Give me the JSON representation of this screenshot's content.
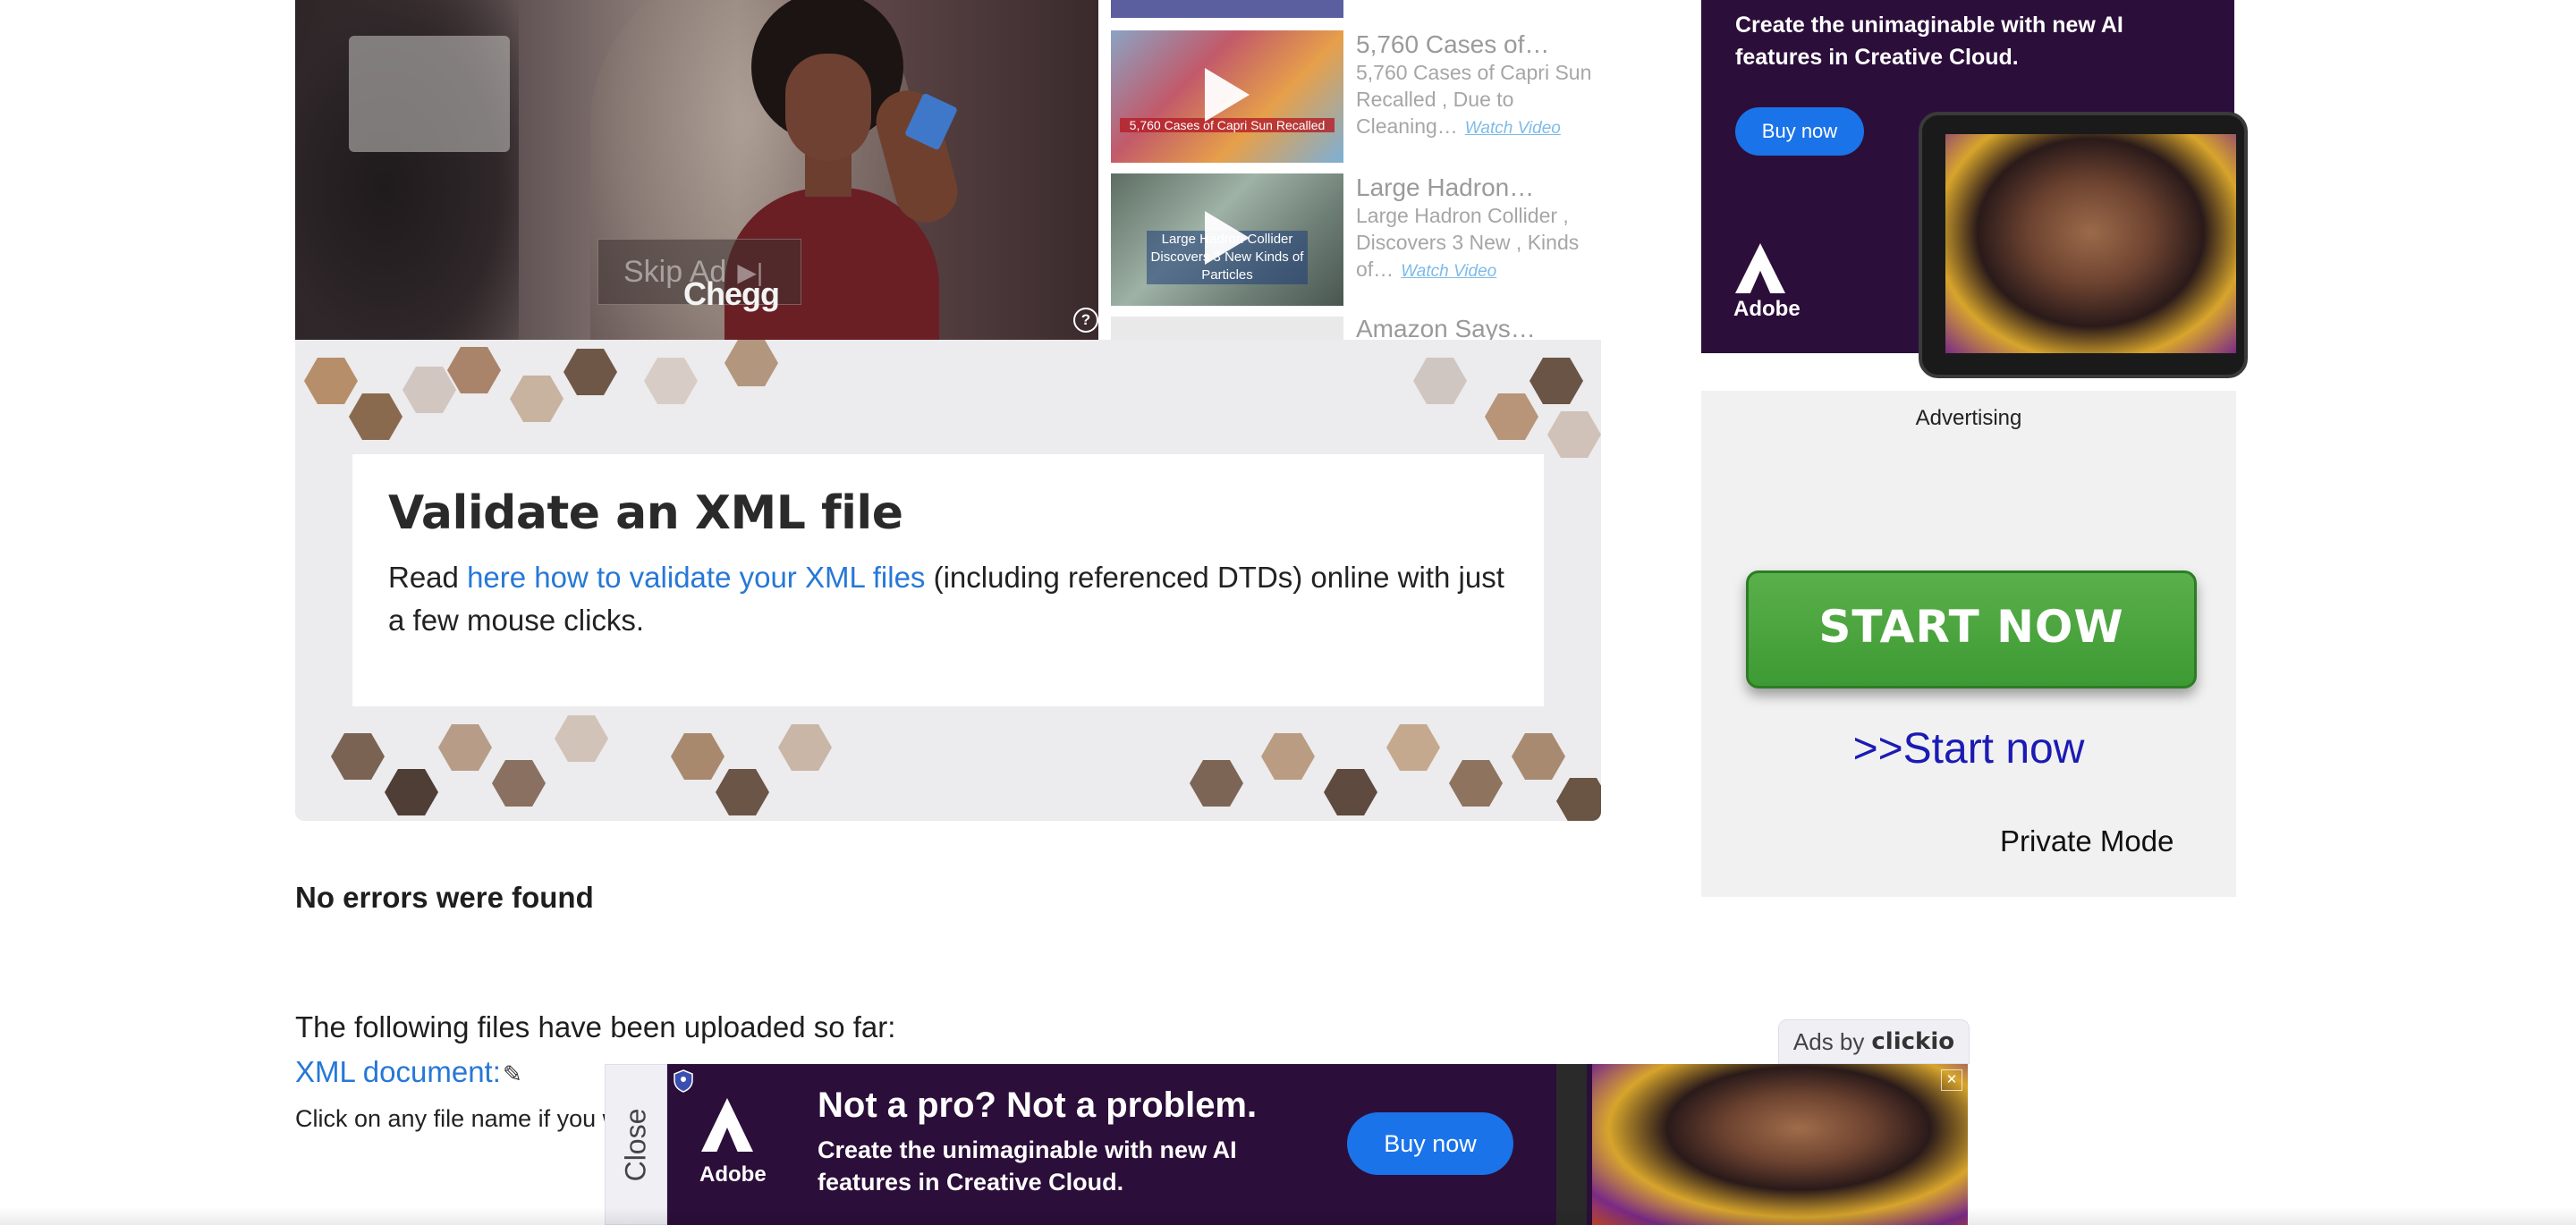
{
  "video": {
    "skip_label": "Skip Ad",
    "skip_icon": "skip-next-icon",
    "brand": "Chegg",
    "help_icon": "?"
  },
  "playlist": [
    {
      "title": "5,760 Cases of…",
      "desc": "5,760 Cases of Capri Sun Recalled , Due to Cleaning…",
      "watch": "Watch Video",
      "thumb_caption": "5,760 Cases of Capri Sun Recalled"
    },
    {
      "title": "Large Hadron…",
      "desc": "Large Hadron Collider , Discovers 3 New , Kinds of…",
      "watch": "Watch Video",
      "thumb_caption": "Large Hadron Collider Discovers 3 New Kinds of Particles"
    },
    {
      "title": "Amazon Says…"
    }
  ],
  "hero": {
    "title": "Validate an XML file",
    "text_before": "Read ",
    "link": "here how to validate your XML files",
    "text_after": " (including referenced DTDs) online with just a few mouse clicks."
  },
  "results": {
    "status": "No errors were found",
    "uploaded_heading": "The following files have been uploaded so far:",
    "file_link": "XML document:",
    "click_hint": "Click on any file name if you w"
  },
  "ad_top": {
    "text": "Create the unimaginable with new AI features in Creative Cloud.",
    "buy": "Buy now",
    "brand": "Adobe"
  },
  "ad_side": {
    "label": "Advertising",
    "button": "START NOW",
    "link": ">>Start now",
    "mode": "Private Mode"
  },
  "sticky_ad": {
    "ads_by": "Ads by",
    "ads_by_brand": "clickio",
    "close": "Close",
    "headline": "Not a pro? Not a problem.",
    "sub": "Create the unimaginable with new AI features in Creative Cloud.",
    "buy": "Buy now",
    "brand": "Adobe"
  },
  "colors": {
    "link": "#2678d6",
    "adobe_bg": "#2c0e3a",
    "adobe_button": "#1a73e8",
    "start_green": "#4aa63c",
    "start_link": "#1b1bb3"
  }
}
